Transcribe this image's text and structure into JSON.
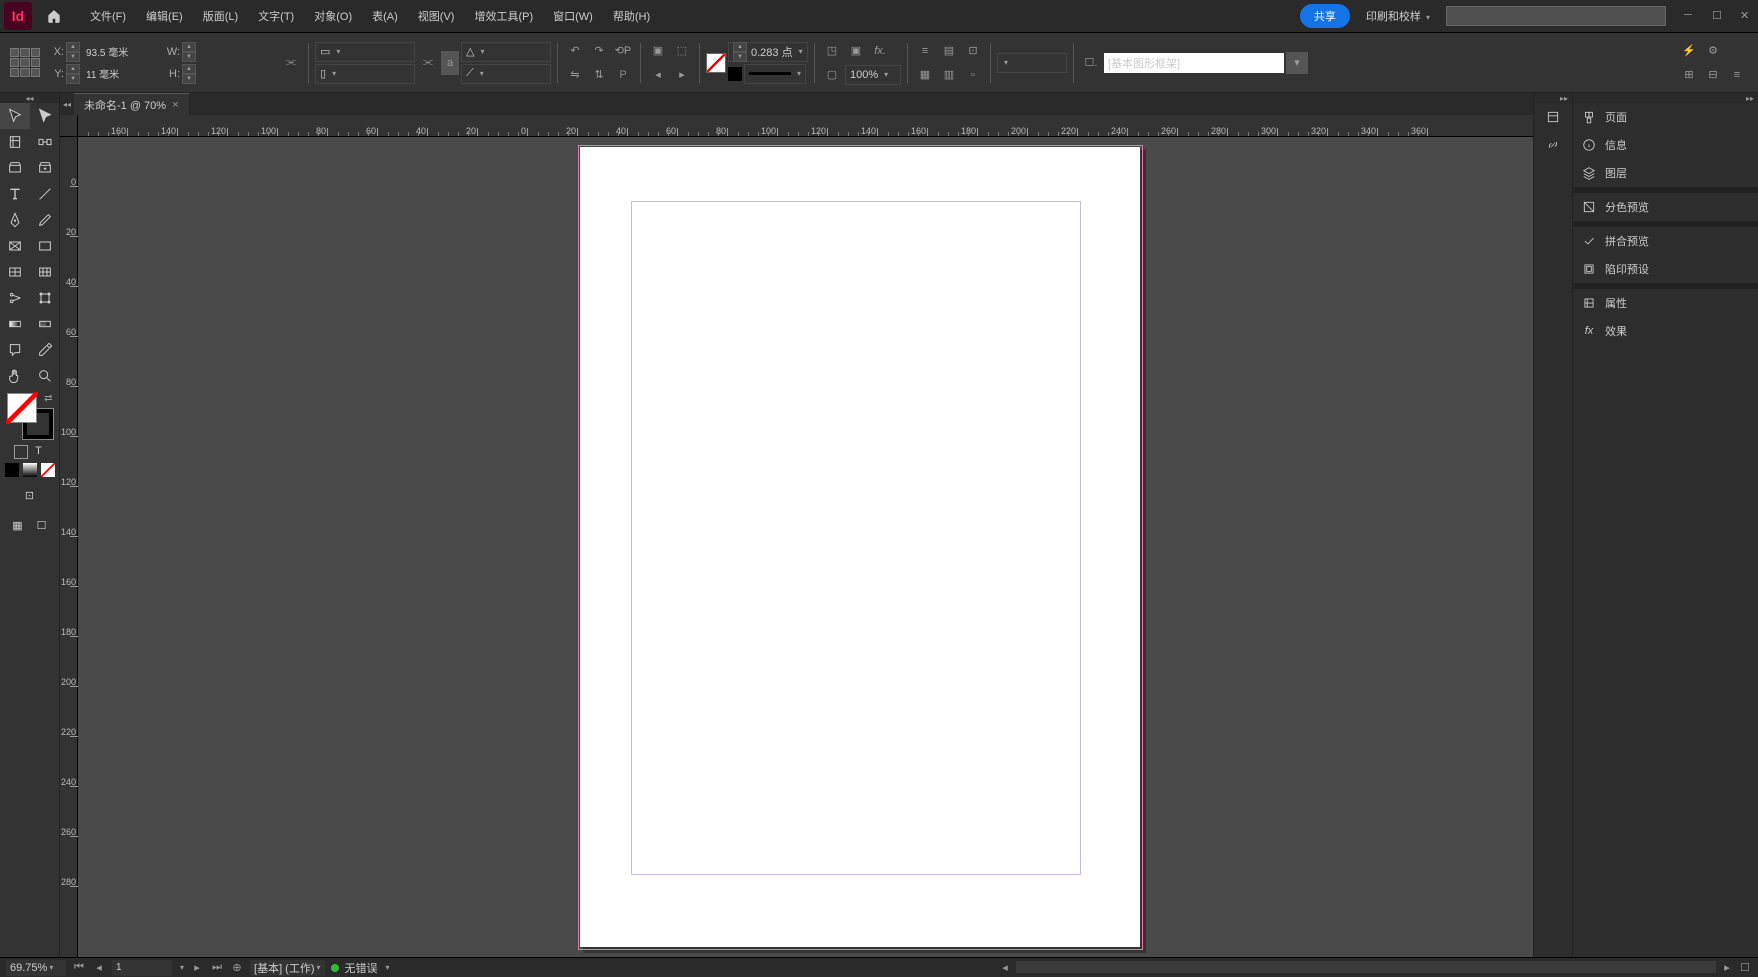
{
  "app": {
    "id_badge": "Id"
  },
  "menu": {
    "file": "文件(F)",
    "edit": "编辑(E)",
    "layout": "版面(L)",
    "type": "文字(T)",
    "object": "对象(O)",
    "table": "表(A)",
    "view": "视图(V)",
    "plugins": "增效工具(P)",
    "window": "窗口(W)",
    "help": "帮助(H)"
  },
  "header": {
    "share": "共享",
    "print_proof": "印刷和校样",
    "search_placeholder": ""
  },
  "controls": {
    "x_label": "X:",
    "y_label": "Y:",
    "x_value": "93.5 毫米",
    "y_value": "11 毫米",
    "w_label": "W:",
    "h_label": "H:",
    "w_value": "",
    "h_value": "",
    "stroke_weight": "0.283 点",
    "opacity": "100%",
    "style_dropdown": "[基本图形框架]"
  },
  "tab": {
    "title": "未命名-1 @ 70%"
  },
  "ruler_h": [
    "160",
    "140",
    "120",
    "100",
    "80",
    "60",
    "40",
    "20",
    "0",
    "20",
    "40",
    "60",
    "80",
    "100",
    "120",
    "140",
    "160",
    "180",
    "200",
    "220",
    "240",
    "260",
    "280",
    "300",
    "320",
    "340",
    "360"
  ],
  "ruler_v": [
    "0",
    "20",
    "40",
    "60",
    "80",
    "100",
    "120",
    "140",
    "160",
    "180",
    "200",
    "220",
    "240",
    "260",
    "280"
  ],
  "panels": {
    "pages": "页面",
    "info": "信息",
    "layers": "图层",
    "separation": "分色预览",
    "flatten": "拼合预览",
    "trap": "陷印预设",
    "properties": "属性",
    "effects": "效果"
  },
  "status": {
    "zoom": "69.75%",
    "page_num": "1",
    "profile": "[基本] (工作)",
    "errors": "无错误"
  }
}
